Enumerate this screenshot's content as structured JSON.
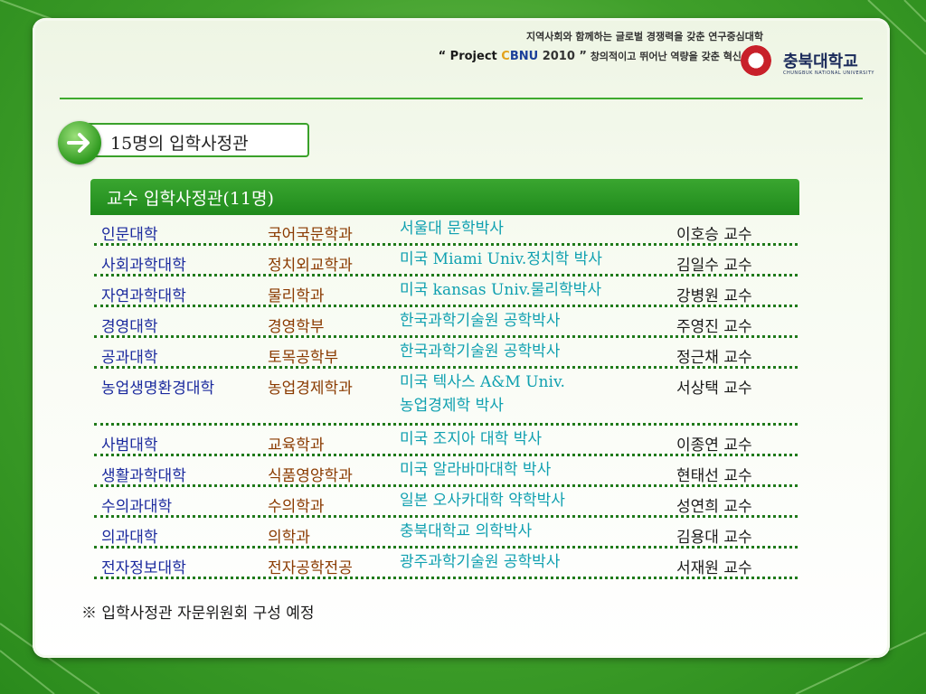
{
  "header": {
    "tagline": "지역사회와 함께하는 글로벌 경쟁력을 갖춘 연구중심대학",
    "project_quote_open": "“ Project ",
    "project_c": "C",
    "project_bnu": "BNU",
    "project_year": " 2010 ”",
    "tagline2": "창의적이고 뛰어난 역량을 갖춘 혁신 대학",
    "university_name": "충북대학교",
    "university_name_en": "CHUNGBUK NATIONAL UNIVERSITY"
  },
  "section": {
    "title": "15명의 입학사정관"
  },
  "table": {
    "header": "교수 입학사정관(11명)",
    "rows": [
      {
        "college": "인문대학",
        "dept": "국어국문학과",
        "degree": "서울대 문학박사",
        "name": "이호승 교수"
      },
      {
        "college": "사회과학대학",
        "dept": "정치외교학과",
        "degree": "미국 Miami Univ.정치학 박사",
        "name": "김일수 교수"
      },
      {
        "college": "자연과학대학",
        "dept": "물리학과",
        "degree": "미국 kansas Univ.물리학박사",
        "name": "강병원 교수"
      },
      {
        "college": "경영대학",
        "dept": "경영학부",
        "degree": "한국과학기술원 공학박사",
        "name": "주영진 교수"
      },
      {
        "college": "공과대학",
        "dept": "토목공학부",
        "degree": "한국과학기술원 공학박사",
        "name": "정근채 교수"
      },
      {
        "college": "농업생명환경대학",
        "dept": "농업경제학과",
        "degree": "미국 텍사스 A&M Univ.",
        "degree2": "농업경제학 박사",
        "name": "서상택 교수"
      },
      {
        "college": "사범대학",
        "dept": "교육학과",
        "degree": "미국 조지아 대학 박사",
        "name": "이종연 교수"
      },
      {
        "college": "생활과학대학",
        "dept": "식품영양학과",
        "degree": "미국 알라바마대학 박사",
        "name": "현태선 교수"
      },
      {
        "college": "수의과대학",
        "dept": "수의학과",
        "degree": "일본 오사카대학 약학박사",
        "name": "성연희 교수"
      },
      {
        "college": "의과대학",
        "dept": "의학과",
        "degree": "충북대학교 의학박사",
        "name": "김용대 교수"
      },
      {
        "college": "전자정보대학",
        "dept": "전자공학전공",
        "degree": "광주과학기술원 공학박사",
        "name": "서재원 교수"
      }
    ]
  },
  "note": "※ 입학사정관 자문위원회 구성 예정",
  "colors": {
    "accent_green": "#2f9a1f",
    "college_text": "#1b2a9e",
    "dept_text": "#8a3a00",
    "degree_text": "#0fa0b0"
  },
  "icons": {
    "arrow": "arrow-right-icon",
    "logo": "university-seal-icon"
  }
}
